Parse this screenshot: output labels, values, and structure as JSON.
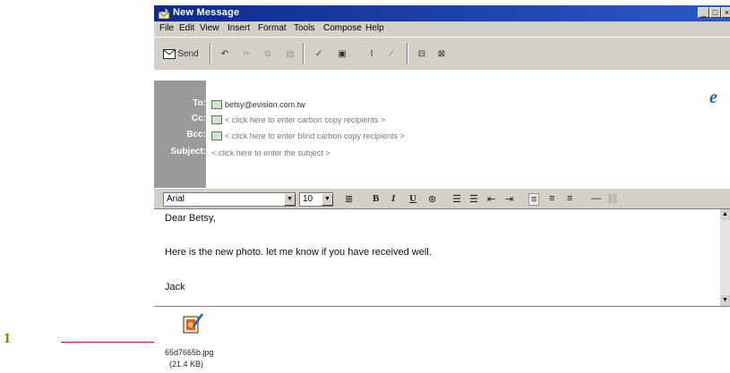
{
  "annotation": {
    "number": "1"
  },
  "window": {
    "title": "New Message",
    "controls": [
      "_",
      "□",
      "×"
    ]
  },
  "menu": [
    {
      "label": "File"
    },
    {
      "label": "Edit"
    },
    {
      "label": "View"
    },
    {
      "label": "Insert"
    },
    {
      "label": "Format"
    },
    {
      "label": "Tools"
    },
    {
      "label": "Compose"
    },
    {
      "label": "Help"
    }
  ],
  "toolbar": {
    "send_label": "Send",
    "icons": [
      "undo-icon",
      "cut-icon",
      "copy-icon",
      "paste-icon",
      "check-names-icon",
      "address-book-icon",
      "attach-icon",
      "signature-icon",
      "priority-icon",
      "sign-icon"
    ]
  },
  "header": {
    "to_label": "To:",
    "cc_label": "Cc:",
    "bcc_label": "Bcc:",
    "subject_label": "Subject:",
    "to_value": "betsy@evision.com.tw",
    "cc_placeholder": "< click here to enter carbon copy recipients >",
    "bcc_placeholder": "< click here to enter blind carbon copy recipients >",
    "subject_placeholder": "< click here to enter the subject >"
  },
  "format": {
    "font": "Arial",
    "size": "10"
  },
  "message": {
    "line1": "Dear Betsy,",
    "line2": "Here is the new photo.   let me know if you have received well.",
    "line3": "Jack"
  },
  "attachment": {
    "filename": "65d7665b.jpg",
    "size": "(21.4 KB)"
  }
}
